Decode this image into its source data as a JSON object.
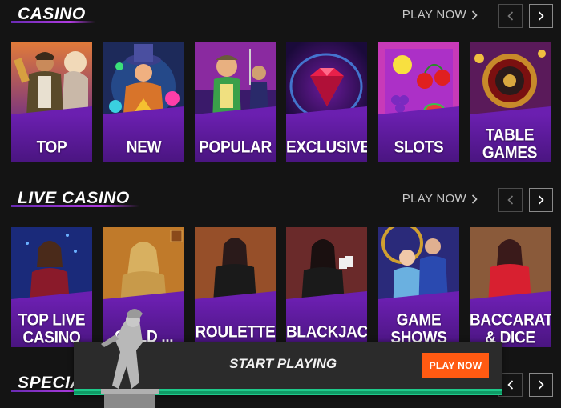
{
  "sections": [
    {
      "title": "CASINO",
      "play_now": "PLAY NOW",
      "cards": [
        {
          "label": "TOP"
        },
        {
          "label": "NEW"
        },
        {
          "label": "POPULAR"
        },
        {
          "label": "EXCLUSIVE"
        },
        {
          "label": "SLOTS"
        },
        {
          "label": "TABLE GAMES"
        }
      ]
    },
    {
      "title": "LIVE CASINO",
      "play_now": "PLAY NOW",
      "cards": [
        {
          "label": "TOP LIVE CASINO"
        },
        {
          "label": "GOLD ..."
        },
        {
          "label": "ROULETTE"
        },
        {
          "label": "BLACKJACK"
        },
        {
          "label": "GAME SHOWS"
        },
        {
          "label": "BACCARAT & DICE"
        }
      ]
    },
    {
      "title": "SPECIA..."
    }
  ],
  "banner": {
    "text": "START PLAYING",
    "button": "PLAY NOW"
  },
  "colors": {
    "background": "#141414",
    "card_band": "#6b1fb0",
    "cta": "#ff5a12",
    "banner_bar": "#1ec98a"
  }
}
